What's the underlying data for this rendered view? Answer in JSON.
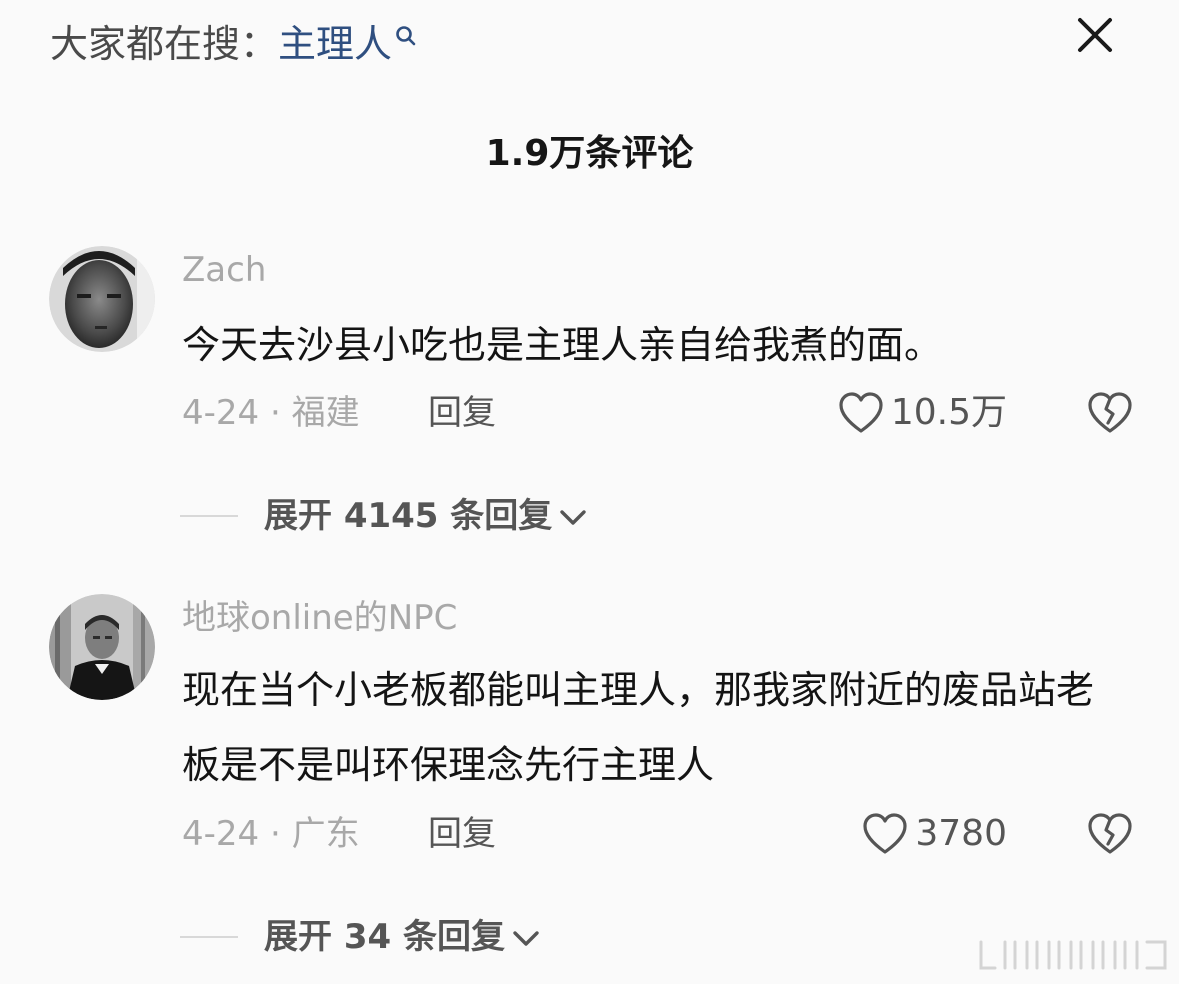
{
  "search": {
    "prefix": "大家都在搜：",
    "term": "主理人"
  },
  "header": {
    "comment_count": "1.9万条评论"
  },
  "comments": [
    {
      "username": "Zach",
      "text": "今天去沙县小吃也是主理人亲自给我煮的面。",
      "date_location": "4-24 · 福建",
      "reply_label": "回复",
      "likes": "10.5万",
      "expand_label": "展开 4145 条回复"
    },
    {
      "username": "地球online的NPC",
      "text": "现在当个小老板都能叫主理人，那我家附近的废品站老板是不是叫环保理念先行主理人",
      "date_location": "4-24 · 广东",
      "reply_label": "回复",
      "likes": "3780",
      "expand_label": "展开 34 条回复"
    }
  ],
  "colors": {
    "background": "#fafafa",
    "search_term": "#2f4f80",
    "muted_text": "#a8a8a8",
    "secondary_text": "#555555",
    "primary_text": "#141414"
  }
}
